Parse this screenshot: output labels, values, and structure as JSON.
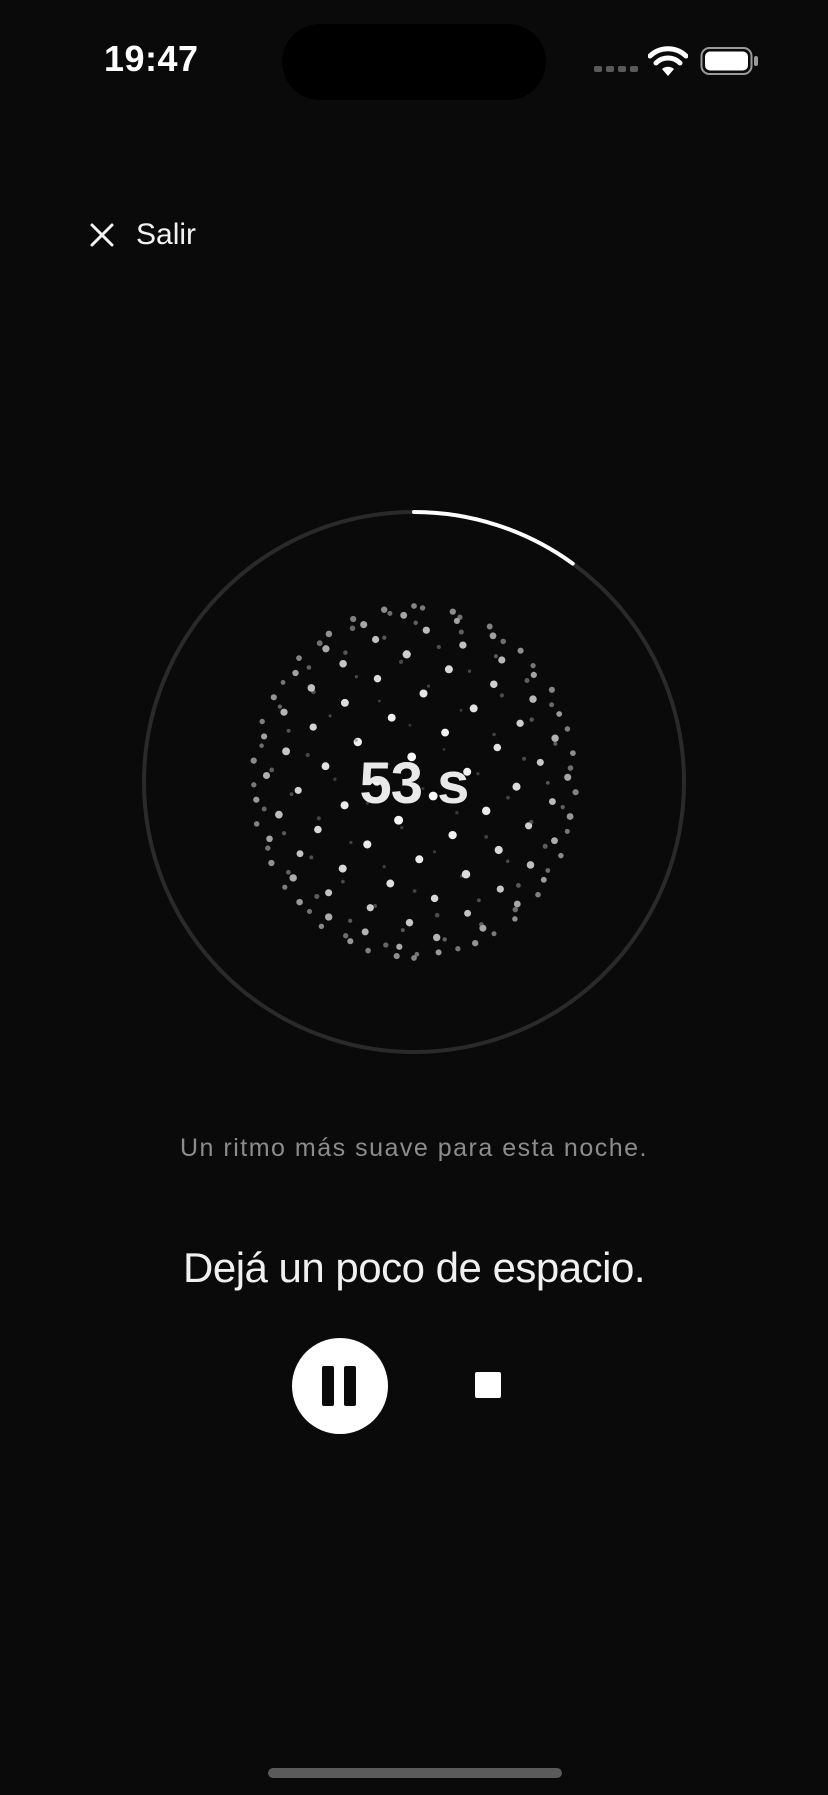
{
  "status_bar": {
    "time": "19:47",
    "icons": [
      "cellular-signal-icon",
      "wifi-icon",
      "battery-icon"
    ]
  },
  "header": {
    "exit_label": "Salir",
    "exit_icon": "close-icon"
  },
  "timer": {
    "value": "53 s",
    "progress": 0.1,
    "ring_track_color": "#2a2a2a",
    "ring_progress_color": "#ffffff"
  },
  "session": {
    "subtitle": "Un ritmo más suave para esta noche.",
    "prompt": "Dejá un poco de espacio."
  },
  "controls": {
    "pause_icon": "pause-icon",
    "stop_icon": "stop-icon"
  },
  "colors": {
    "background": "#0a0a0a",
    "text_primary": "#f0f0f0",
    "text_secondary": "#8c8c8c"
  }
}
